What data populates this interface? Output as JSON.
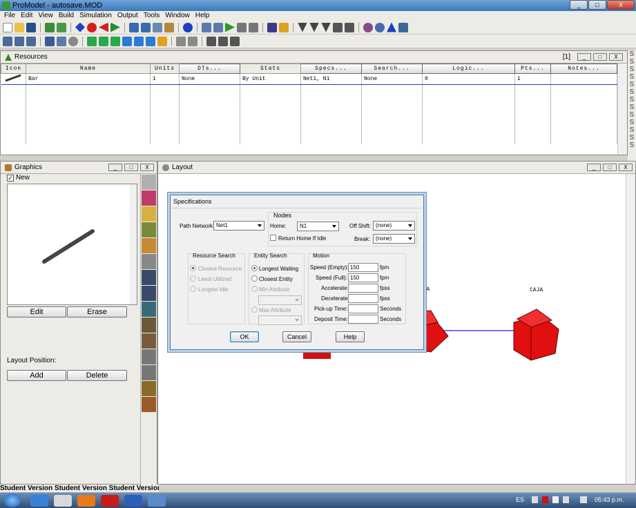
{
  "window": {
    "title": "ProModel - autosave.MOD",
    "minimize": "_",
    "maximize": "□",
    "close": "X"
  },
  "menu": [
    "File",
    "Edit",
    "View",
    "Build",
    "Simulation",
    "Output",
    "Tools",
    "Window",
    "Help"
  ],
  "resources": {
    "title": "Resources",
    "record_count": "[1]",
    "headers": [
      "Icon",
      "Name",
      "Units",
      "DTs...",
      "Stats",
      "Specs...",
      "Search...",
      "Logic...",
      "Pts...",
      "Notes..."
    ],
    "row": {
      "name": "Bar",
      "units": "1",
      "dts": "None",
      "stats": "By Unit",
      "specs": "Net1, N1",
      "search": "None",
      "logic": "0",
      "pts": "1",
      "notes": ""
    }
  },
  "graphics": {
    "title": "Graphics",
    "new_label": "New",
    "new_checked": true,
    "edit_label": "Edit",
    "erase_label": "Erase",
    "layout_position_label": "Layout Position:",
    "add_label": "Add",
    "delete_label": "Delete"
  },
  "layout": {
    "title": "Layout",
    "boxes": [
      "CAJA",
      "CAJA"
    ]
  },
  "spec": {
    "title": "Specifications",
    "path_network_label": "Path Network:",
    "path_network_value": "Net1",
    "nodes_label": "Nodes",
    "home_label": "Home:",
    "home_value": "N1",
    "return_home_label": "Return Home If Idle",
    "off_shift_label": "Off Shift:",
    "off_shift_value": "(none)",
    "break_label": "Break:",
    "break_value": "(none)",
    "resource_search_label": "Resource Search",
    "rs_options": [
      "Closest Resource",
      "Least Utilized",
      "Longest Idle"
    ],
    "entity_search_label": "Entity Search",
    "es_options": [
      "Longest Waiting",
      "Closest Entity",
      "Min Attribute",
      "Max Attribute"
    ],
    "motion_label": "Motion",
    "motion_rows": [
      {
        "label": "Speed (Empty):",
        "value": "150",
        "unit": "fpm"
      },
      {
        "label": "Speed (Full):",
        "value": "150",
        "unit": "fpm"
      },
      {
        "label": "Accelerate",
        "value": "",
        "unit": "fpss"
      },
      {
        "label": "Decelerate",
        "value": "",
        "unit": "fpss"
      },
      {
        "label": "Pick-up Time:",
        "value": "",
        "unit": "Seconds"
      },
      {
        "label": "Deposit Time:",
        "value": "",
        "unit": "Seconds"
      }
    ],
    "ok_label": "OK",
    "cancel_label": "Cancel",
    "help_label": "Help"
  },
  "status": {
    "student": "Student Version Student Version Student Version"
  },
  "taskbar": {
    "lang": "ES",
    "time": "05:43 p.m."
  },
  "colors": {
    "box_red": "#e01010",
    "path_blue": "#1a1aff",
    "title_blue": "#3b78bd"
  }
}
